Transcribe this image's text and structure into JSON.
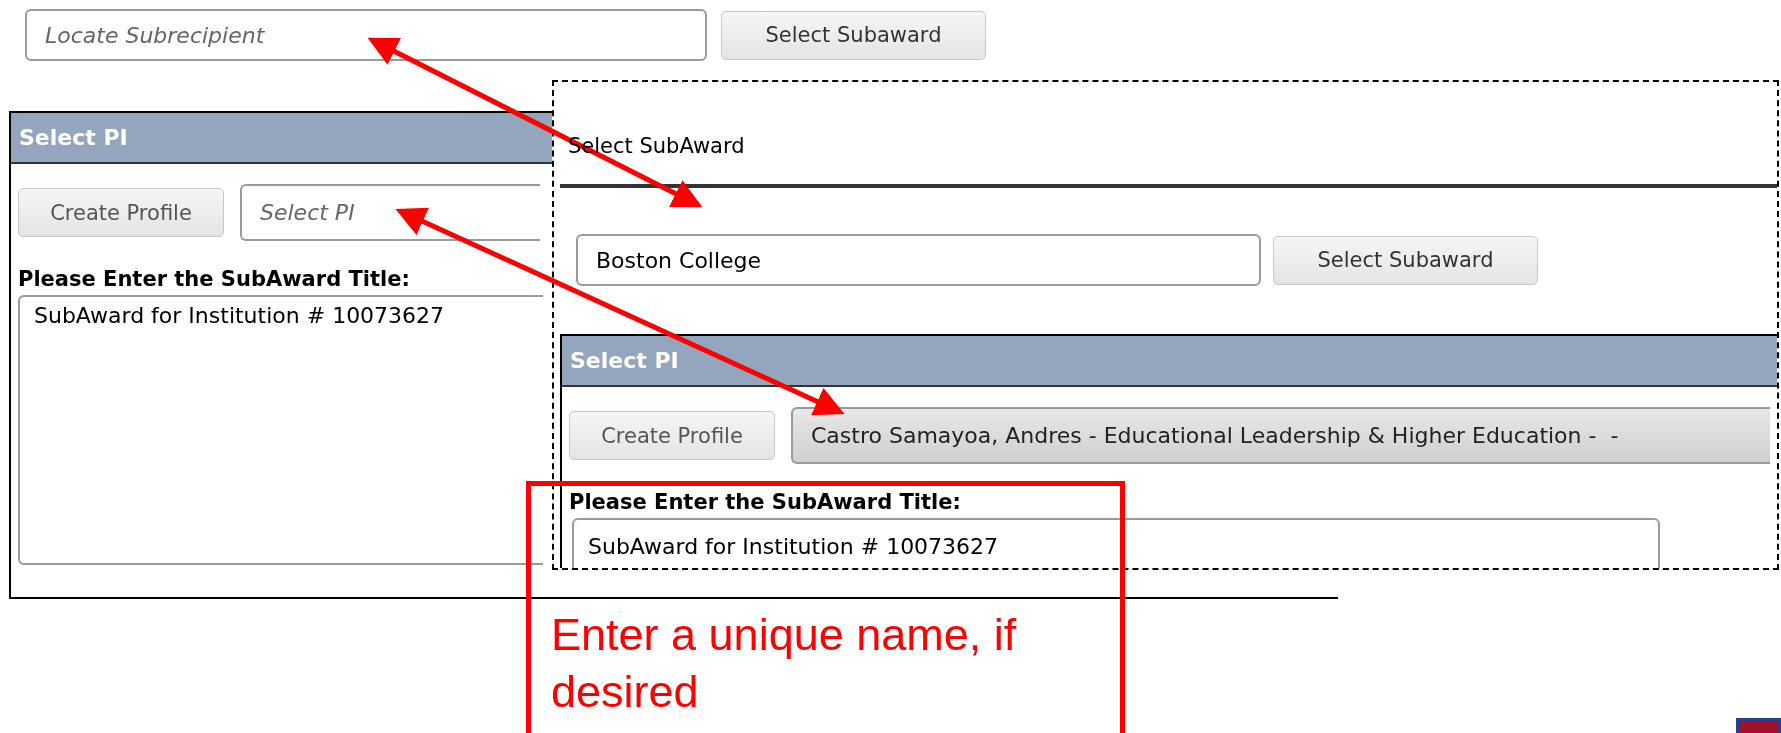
{
  "search_row": {
    "subrecipient_field": {
      "placeholder": "Locate Subrecipient"
    },
    "select_button": "Select Subaward"
  },
  "before_panel": {
    "header": "Select PI",
    "create_button": "Create Profile",
    "pi_field": {
      "placeholder": "Select PI"
    },
    "title_label": "Please Enter the SubAward Title:",
    "title_field": {
      "value": "SubAward for Institution # 10073627"
    }
  },
  "after_panel": {
    "heading": "Select SubAward",
    "subrecipient_field": {
      "value": "Boston College"
    },
    "select_button": "Select Subaward",
    "pi_panel": {
      "header": "Select PI",
      "create_button": "Create Profile",
      "pi_dropdown": {
        "value": "Castro Samayoa, Andres - Educational Leadership & Higher Education -  -"
      },
      "title_label": "Please Enter the SubAward Title:",
      "title_field": {
        "value": "SubAward for Institution # 10073627"
      }
    }
  },
  "callout": {
    "text": "Enter a unique name, if desired"
  }
}
